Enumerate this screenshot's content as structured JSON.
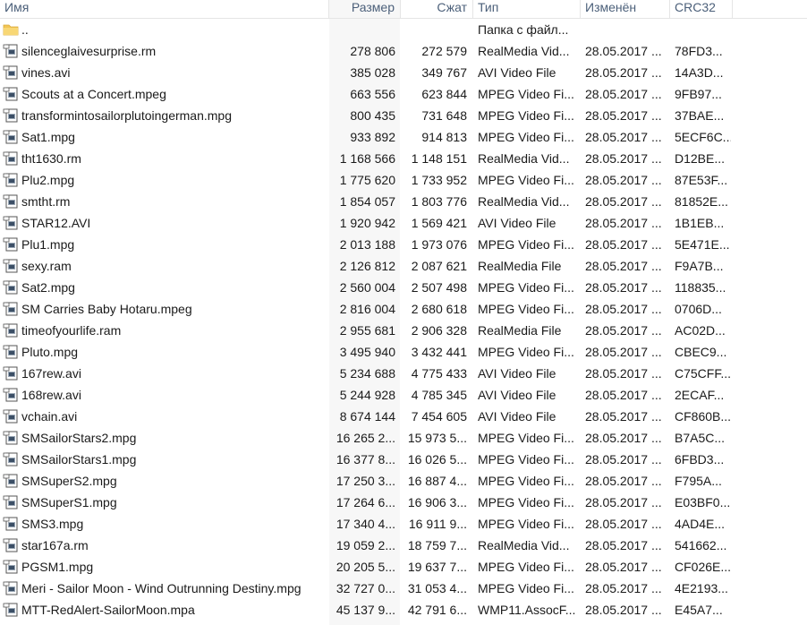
{
  "columns": {
    "name": "Имя",
    "size": "Размер",
    "packed": "Сжат",
    "type": "Тип",
    "modified": "Изменён",
    "crc": "CRC32"
  },
  "parent_row": {
    "name": "..",
    "type": "Папка с файл...",
    "icon": "folder-icon"
  },
  "files": [
    {
      "name": "silenceglaivesurprise.rm",
      "size": "278 806",
      "packed": "272 579",
      "type": "RealMedia Vid...",
      "modified": "28.05.2017 ...",
      "crc": "78FD3...",
      "icon": "media-file-icon"
    },
    {
      "name": "vines.avi",
      "size": "385 028",
      "packed": "349 767",
      "type": "AVI Video File",
      "modified": "28.05.2017 ...",
      "crc": "14A3D...",
      "icon": "media-file-icon"
    },
    {
      "name": "Scouts at a Concert.mpeg",
      "size": "663 556",
      "packed": "623 844",
      "type": "MPEG Video Fi...",
      "modified": "28.05.2017 ...",
      "crc": "9FB97...",
      "icon": "media-file-icon"
    },
    {
      "name": "transformintosailorplutoingerman.mpg",
      "size": "800 435",
      "packed": "731 648",
      "type": "MPEG Video Fi...",
      "modified": "28.05.2017 ...",
      "crc": "37BAE...",
      "icon": "media-file-icon"
    },
    {
      "name": "Sat1.mpg",
      "size": "933 892",
      "packed": "914 813",
      "type": "MPEG Video Fi...",
      "modified": "28.05.2017 ...",
      "crc": "5ECF6C...",
      "icon": "media-file-icon"
    },
    {
      "name": "tht1630.rm",
      "size": "1 168 566",
      "packed": "1 148 151",
      "type": "RealMedia Vid...",
      "modified": "28.05.2017 ...",
      "crc": "D12BE...",
      "icon": "media-file-icon"
    },
    {
      "name": "Plu2.mpg",
      "size": "1 775 620",
      "packed": "1 733 952",
      "type": "MPEG Video Fi...",
      "modified": "28.05.2017 ...",
      "crc": "87E53F...",
      "icon": "media-file-icon"
    },
    {
      "name": "smtht.rm",
      "size": "1 854 057",
      "packed": "1 803 776",
      "type": "RealMedia Vid...",
      "modified": "28.05.2017 ...",
      "crc": "81852E...",
      "icon": "media-file-icon"
    },
    {
      "name": "STAR12.AVI",
      "size": "1 920 942",
      "packed": "1 569 421",
      "type": "AVI Video File",
      "modified": "28.05.2017 ...",
      "crc": "1B1EB...",
      "icon": "media-file-icon"
    },
    {
      "name": "Plu1.mpg",
      "size": "2 013 188",
      "packed": "1 973 076",
      "type": "MPEG Video Fi...",
      "modified": "28.05.2017 ...",
      "crc": "5E471E...",
      "icon": "media-file-icon"
    },
    {
      "name": "sexy.ram",
      "size": "2 126 812",
      "packed": "2 087 621",
      "type": "RealMedia File",
      "modified": "28.05.2017 ...",
      "crc": "F9A7B...",
      "icon": "media-file-icon"
    },
    {
      "name": "Sat2.mpg",
      "size": "2 560 004",
      "packed": "2 507 498",
      "type": "MPEG Video Fi...",
      "modified": "28.05.2017 ...",
      "crc": "118835...",
      "icon": "media-file-icon"
    },
    {
      "name": "SM Carries Baby Hotaru.mpeg",
      "size": "2 816 004",
      "packed": "2 680 618",
      "type": "MPEG Video Fi...",
      "modified": "28.05.2017 ...",
      "crc": "0706D...",
      "icon": "media-file-icon"
    },
    {
      "name": "timeofyourlife.ram",
      "size": "2 955 681",
      "packed": "2 906 328",
      "type": "RealMedia File",
      "modified": "28.05.2017 ...",
      "crc": "AC02D...",
      "icon": "media-file-icon"
    },
    {
      "name": "Pluto.mpg",
      "size": "3 495 940",
      "packed": "3 432 441",
      "type": "MPEG Video Fi...",
      "modified": "28.05.2017 ...",
      "crc": "CBEC9...",
      "icon": "media-file-icon"
    },
    {
      "name": "167rew.avi",
      "size": "5 234 688",
      "packed": "4 775 433",
      "type": "AVI Video File",
      "modified": "28.05.2017 ...",
      "crc": "C75CFF...",
      "icon": "media-file-icon"
    },
    {
      "name": "168rew.avi",
      "size": "5 244 928",
      "packed": "4 785 345",
      "type": "AVI Video File",
      "modified": "28.05.2017 ...",
      "crc": "2ECAF...",
      "icon": "media-file-icon"
    },
    {
      "name": "vchain.avi",
      "size": "8 674 144",
      "packed": "7 454 605",
      "type": "AVI Video File",
      "modified": "28.05.2017 ...",
      "crc": "CF860B...",
      "icon": "media-file-icon"
    },
    {
      "name": "SMSailorStars2.mpg",
      "size": "16 265 2...",
      "packed": "15 973 5...",
      "type": "MPEG Video Fi...",
      "modified": "28.05.2017 ...",
      "crc": "B7A5C...",
      "icon": "media-file-icon"
    },
    {
      "name": "SMSailorStars1.mpg",
      "size": "16 377 8...",
      "packed": "16 026 5...",
      "type": "MPEG Video Fi...",
      "modified": "28.05.2017 ...",
      "crc": "6FBD3...",
      "icon": "media-file-icon"
    },
    {
      "name": "SMSuperS2.mpg",
      "size": "17 250 3...",
      "packed": "16 887 4...",
      "type": "MPEG Video Fi...",
      "modified": "28.05.2017 ...",
      "crc": "F795A...",
      "icon": "media-file-icon"
    },
    {
      "name": "SMSuperS1.mpg",
      "size": "17 264 6...",
      "packed": "16 906 3...",
      "type": "MPEG Video Fi...",
      "modified": "28.05.2017 ...",
      "crc": "E03BF0...",
      "icon": "media-file-icon"
    },
    {
      "name": "SMS3.mpg",
      "size": "17 340 4...",
      "packed": "16 911 9...",
      "type": "MPEG Video Fi...",
      "modified": "28.05.2017 ...",
      "crc": "4AD4E...",
      "icon": "media-file-icon"
    },
    {
      "name": "star167a.rm",
      "size": "19 059 2...",
      "packed": "18 759 7...",
      "type": "RealMedia Vid...",
      "modified": "28.05.2017 ...",
      "crc": "541662...",
      "icon": "media-file-icon"
    },
    {
      "name": "PGSM1.mpg",
      "size": "20 205 5...",
      "packed": "19 637 7...",
      "type": "MPEG Video Fi...",
      "modified": "28.05.2017 ...",
      "crc": "CF026E...",
      "icon": "media-file-icon"
    },
    {
      "name": "Meri - Sailor Moon - Wind Outrunning Destiny.mpg",
      "size": "32 727 0...",
      "packed": "31 053 4...",
      "type": "MPEG Video Fi...",
      "modified": "28.05.2017 ...",
      "crc": "4E2193...",
      "icon": "media-file-icon"
    },
    {
      "name": "MTT-RedAlert-SailorMoon.mpa",
      "size": "45 137 9...",
      "packed": "42 791 6...",
      "type": "WMP11.AssocF...",
      "modified": "28.05.2017 ...",
      "crc": "E45A7...",
      "icon": "media-file-icon"
    }
  ]
}
